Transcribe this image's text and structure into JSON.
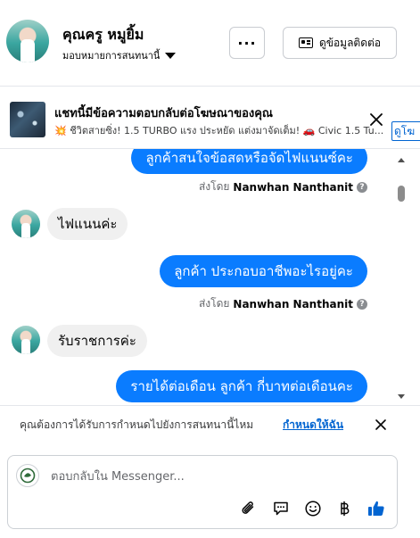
{
  "header": {
    "name": "คุณครู หมูยิ้ม",
    "assign_label": "มอบหมายการสนทนานี้",
    "more_label": "···",
    "contact_button": "ดูข้อมูลติดต่อ"
  },
  "ad": {
    "title": "แชทนี้มีข้อความตอบกลับต่อโฆษณาของคุณ",
    "subtitle": "💥 ชีวิตสายซิ่ง! 1.5 TURBO แรง ประหยัด แต่งมาจัดเต็ม! 🚗 Civic 1.5 Tu...",
    "link_label": "ดูโฆ"
  },
  "messages": [
    {
      "direction": "out",
      "text": "ลูกค้าสนใจข้อสดหรือจัดไฟแนนซ์คะ",
      "sent_by_prefix": "ส่งโดย",
      "sent_by": "Nanwhan Nanthanit"
    },
    {
      "direction": "in",
      "text": "ไฟแนนค่ะ"
    },
    {
      "direction": "out",
      "text": "ลูกค้า   ประกอบอาชีพอะไรอยู่คะ",
      "sent_by_prefix": "ส่งโดย",
      "sent_by": "Nanwhan Nanthanit"
    },
    {
      "direction": "in",
      "text": "รับราชการค่ะ"
    },
    {
      "direction": "out",
      "text": "รายได้ต่อเดือน  ลูกค้า กี่บาทต่อเดือนคะ"
    }
  ],
  "assign_prompt": {
    "text": "คุณต้องการได้รับการกำหนดไปยังการสนทนานี้ไหม",
    "link": "กำหนดให้ฉัน"
  },
  "composer": {
    "placeholder": "ตอบกลับใน Messenger..."
  },
  "icons": {
    "attach": "paperclip-icon",
    "saved_replies": "chat-bubble-icon",
    "emoji": "smiley-icon",
    "payment": "baht-icon",
    "like": "thumbs-up-icon"
  },
  "colors": {
    "outgoing_bubble": "#0a7cff",
    "incoming_bubble": "#f0f0f0",
    "link": "#0064d1",
    "like_icon": "#0064d1"
  }
}
